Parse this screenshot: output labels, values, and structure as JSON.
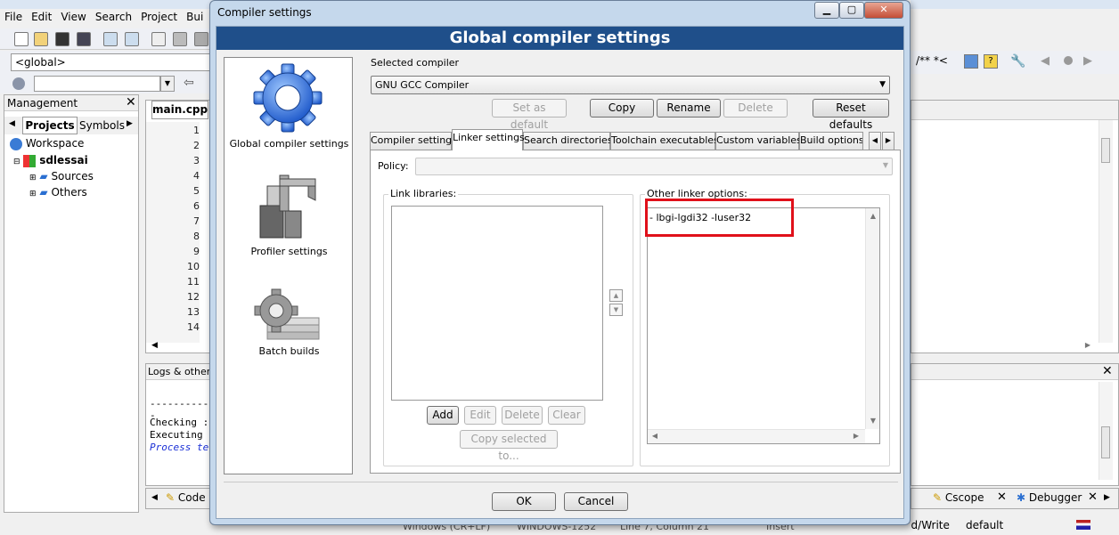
{
  "ide": {
    "menu": [
      "File",
      "Edit",
      "View",
      "Search",
      "Project",
      "Bui"
    ],
    "scope_value": "<global>",
    "management_title": "Management",
    "panel_tabs": [
      "Projects",
      "Symbols"
    ],
    "tree": {
      "workspace": "Workspace",
      "project": "sdlessai",
      "sources": "Sources",
      "others": "Others"
    },
    "editor_tab": "main.cpp",
    "line_numbers": [
      "1",
      "2",
      "3",
      "4",
      "5",
      "6",
      "7",
      "8",
      "9",
      "10",
      "11",
      "12",
      "13",
      "14"
    ],
    "logs_title": "Logs & others",
    "log_lines": [
      "------------",
      "Checking :",
      "Executing",
      "Process te"
    ],
    "bottom_tabs": [
      "Code",
      "Cscope",
      "Debugger"
    ],
    "right_toolbar_text": "/** *<",
    "status": {
      "eol": "Windows (CR+LF)",
      "encoding": "WINDOWS-1252",
      "position": "Line 7, Column 21",
      "mode": "Insert",
      "access": "Read/Write",
      "profile": "default"
    }
  },
  "dialog": {
    "window_title": "Compiler settings",
    "banner": "Global compiler settings",
    "left_items": [
      {
        "label": "Global compiler settings",
        "icon": "gear-icon"
      },
      {
        "label": "Profiler settings",
        "icon": "caliper-icon"
      },
      {
        "label": "Batch builds",
        "icon": "batch-gear-icon"
      }
    ],
    "selected_compiler_label": "Selected compiler",
    "selected_compiler_value": "GNU GCC Compiler",
    "compiler_buttons": {
      "set_default": "Set as default",
      "copy": "Copy",
      "rename": "Rename",
      "delete": "Delete",
      "reset": "Reset defaults"
    },
    "tabs": [
      "Compiler settings",
      "Linker settings",
      "Search directories",
      "Toolchain executables",
      "Custom variables",
      "Build options"
    ],
    "active_tab": "Linker settings",
    "policy_label": "Policy:",
    "policy_value": "",
    "link_libraries_label": "Link libraries:",
    "link_buttons": {
      "add": "Add",
      "edit": "Edit",
      "delete": "Delete",
      "clear": "Clear",
      "copy_selected": "Copy selected to..."
    },
    "other_linker_label": "Other linker options:",
    "other_linker_value": "- lbgi-lgdi32 -luser32",
    "ok": "OK",
    "cancel": "Cancel",
    "highlight_color": "#e0101a",
    "banner_color": "#1f4f8a"
  }
}
